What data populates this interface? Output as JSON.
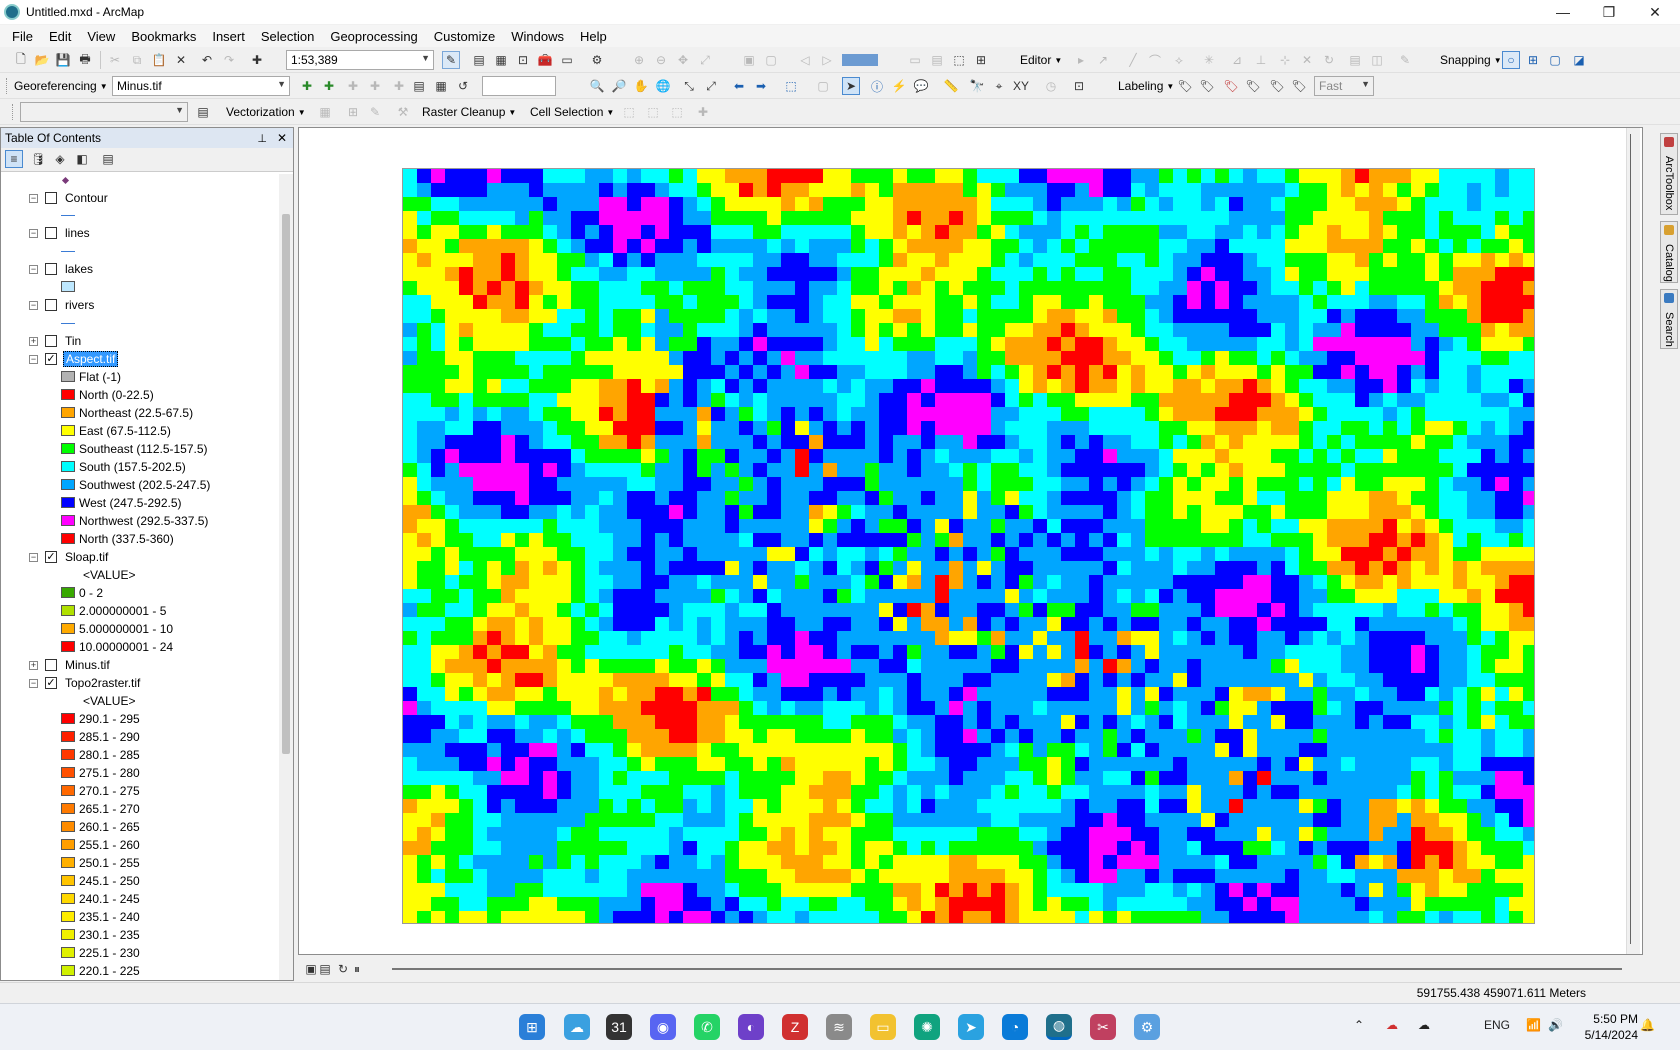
{
  "window": {
    "title": "Untitled.mxd - ArcMap",
    "minimize": "—",
    "maximize": "❐",
    "close": "✕"
  },
  "menu": [
    "File",
    "Edit",
    "View",
    "Bookmarks",
    "Insert",
    "Selection",
    "Geoprocessing",
    "Customize",
    "Windows",
    "Help"
  ],
  "toolbar1": {
    "scale": "1:53,389",
    "editor": "Editor",
    "snapping": "Snapping"
  },
  "toolbar2": {
    "georeferencing": "Georeferencing",
    "layer": "Minus.tif",
    "labeling": "Labeling",
    "fast": "Fast"
  },
  "toolbar3": {
    "vectorization": "Vectorization",
    "raster_cleanup": "Raster Cleanup",
    "cell_selection": "Cell Selection"
  },
  "toc": {
    "title": "Table Of Contents",
    "pin": "📌",
    "close": "✕",
    "layers": {
      "contour": "Contour",
      "lines": "lines",
      "lakes": "lakes",
      "rivers": "rivers",
      "tin": "Tin",
      "aspect": "Aspect.tif",
      "sloap": "Sloap.tif",
      "minus": "Minus.tif",
      "topo": "Topo2raster.tif"
    },
    "aspect_classes": [
      {
        "label": "Flat (-1)",
        "color": "#b2b2b2"
      },
      {
        "label": "North (0-22.5)",
        "color": "#ff0000"
      },
      {
        "label": "Northeast (22.5-67.5)",
        "color": "#ffa500"
      },
      {
        "label": "East (67.5-112.5)",
        "color": "#ffff00"
      },
      {
        "label": "Southeast (112.5-157.5)",
        "color": "#00ff00"
      },
      {
        "label": "South (157.5-202.5)",
        "color": "#00ffff"
      },
      {
        "label": "Southwest (202.5-247.5)",
        "color": "#00a6ff"
      },
      {
        "label": "West (247.5-292.5)",
        "color": "#0000ff"
      },
      {
        "label": "Northwest (292.5-337.5)",
        "color": "#ff00ff"
      },
      {
        "label": "North (337.5-360)",
        "color": "#ff0000"
      }
    ],
    "value_heading": "<VALUE>",
    "sloap_classes": [
      {
        "label": "0 - 2",
        "color": "#38a800"
      },
      {
        "label": "2.000000001 - 5",
        "color": "#b0e000"
      },
      {
        "label": "5.000000001 - 10",
        "color": "#ffaa00"
      },
      {
        "label": "10.00000001 - 24",
        "color": "#ff0000"
      }
    ],
    "topo_classes": [
      {
        "label": "290.1 - 295",
        "color": "#ff0000"
      },
      {
        "label": "285.1 - 290",
        "color": "#ff2000"
      },
      {
        "label": "280.1 - 285",
        "color": "#ff3800"
      },
      {
        "label": "275.1 - 280",
        "color": "#ff5000"
      },
      {
        "label": "270.1 - 275",
        "color": "#ff6800"
      },
      {
        "label": "265.1 - 270",
        "color": "#ff7a00"
      },
      {
        "label": "260.1 - 265",
        "color": "#ff8c00"
      },
      {
        "label": "255.1 - 260",
        "color": "#ff9e00"
      },
      {
        "label": "250.1 - 255",
        "color": "#ffb000"
      },
      {
        "label": "245.1 - 250",
        "color": "#ffc400"
      },
      {
        "label": "240.1 - 245",
        "color": "#ffd800"
      },
      {
        "label": "235.1 - 240",
        "color": "#ffec00"
      },
      {
        "label": "230.1 - 235",
        "color": "#f0f000"
      },
      {
        "label": "225.1 - 230",
        "color": "#e0f000"
      },
      {
        "label": "220.1 - 225",
        "color": "#d0f000"
      }
    ]
  },
  "dock": {
    "arctoolbox": "ArcToolbox",
    "catalog": "Catalog",
    "search": "Search"
  },
  "status": {
    "coordinates": "591755.438  459071.611 Meters"
  },
  "taskbar": {
    "lang": "ENG",
    "time": "5:50 PM",
    "date": "5/14/2024"
  },
  "map_palette": [
    "#ff0000",
    "#ffa500",
    "#ffff00",
    "#00ff00",
    "#00ffff",
    "#00a6ff",
    "#0000ff",
    "#ff00ff"
  ]
}
